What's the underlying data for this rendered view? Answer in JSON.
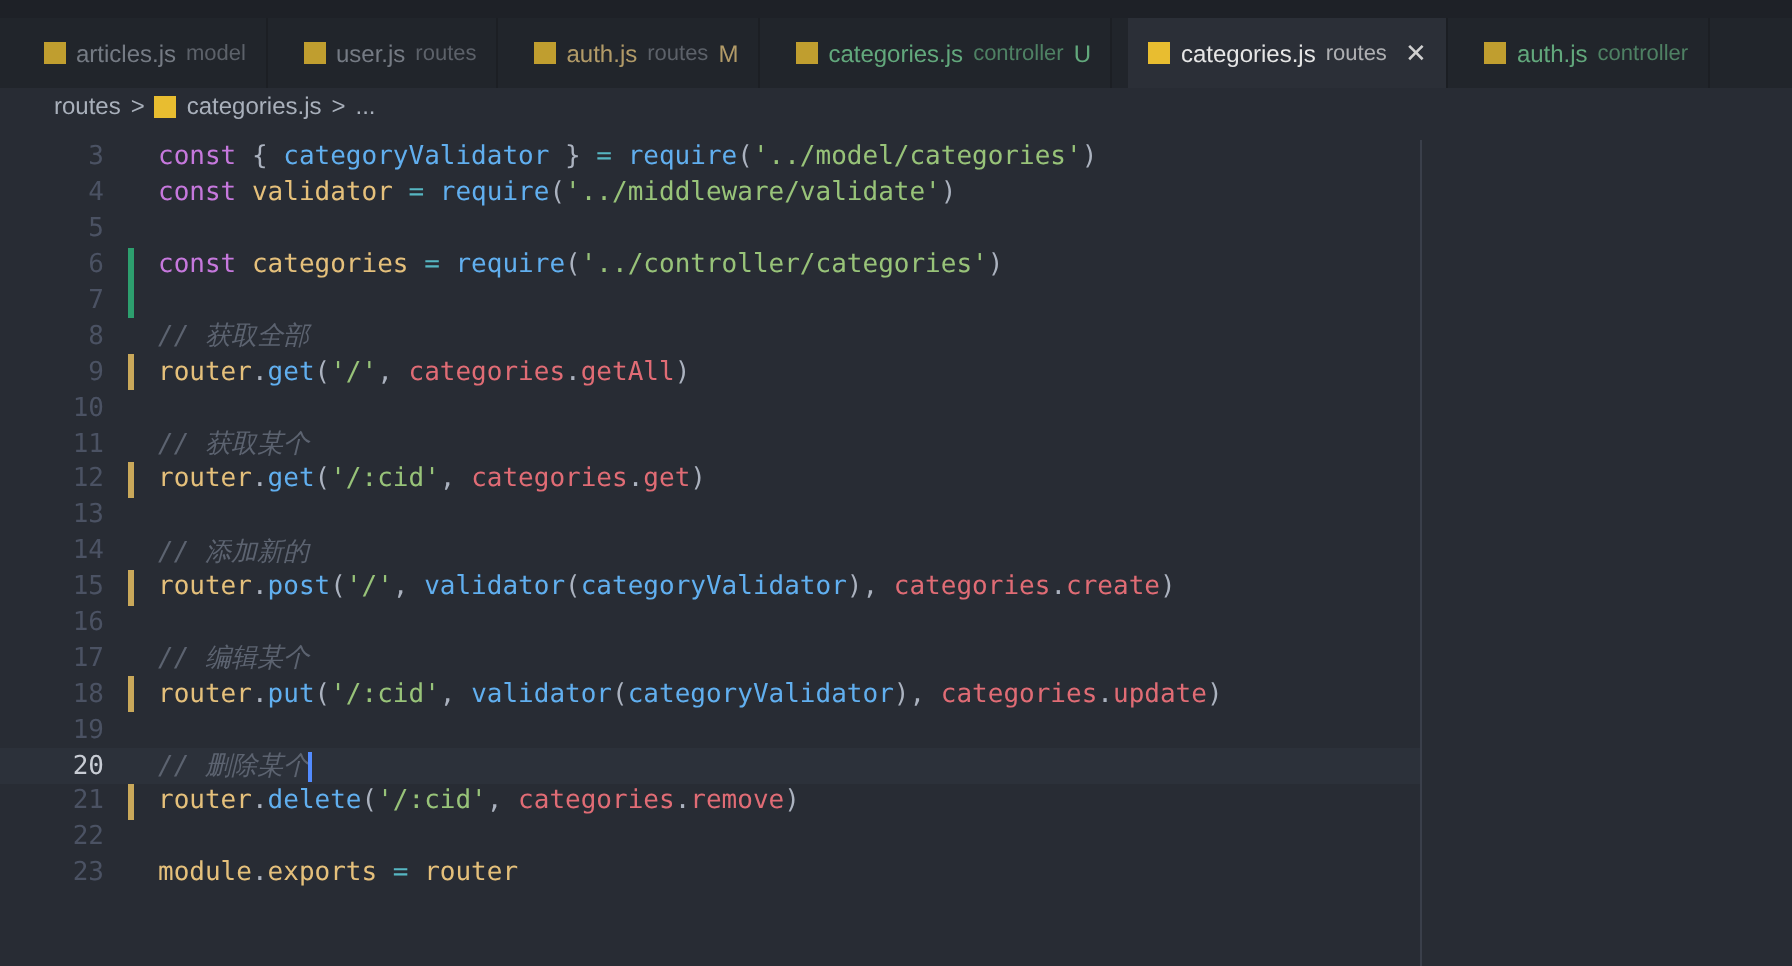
{
  "tabs": [
    {
      "name": "articles.js",
      "description": "model",
      "modified": false,
      "untracked": false,
      "selected": false
    },
    {
      "name": "user.js",
      "description": "routes",
      "modified": false,
      "untracked": false,
      "selected": false
    },
    {
      "name": "auth.js",
      "description": "routes",
      "modified": true,
      "untracked": false,
      "badge": "M",
      "selected": false
    },
    {
      "name": "categories.js",
      "description": "controller",
      "modified": false,
      "untracked": true,
      "badge": "U",
      "selected": false
    },
    {
      "name": "categories.js",
      "description": "routes",
      "modified": false,
      "untracked": false,
      "selected": true,
      "close": "✕"
    },
    {
      "name": "auth.js",
      "description": "controller",
      "modified": false,
      "untracked": true,
      "selected": false
    }
  ],
  "breadcrumb": {
    "folder": "routes",
    "separator_1": ">",
    "file": "categories.js",
    "separator_2": ">",
    "symbol": "..."
  },
  "lines": [
    {
      "number": "3",
      "added": false,
      "modified": false,
      "current": false,
      "tokens": [
        {
          "kind": "keyword",
          "text": "const"
        },
        {
          "kind": "punctuation",
          "text": " { "
        },
        {
          "kind": "function",
          "text": "categoryValidator"
        },
        {
          "kind": "punctuation",
          "text": " } "
        },
        {
          "kind": "operator",
          "text": "= "
        },
        {
          "kind": "function",
          "text": "require"
        },
        {
          "kind": "punctuation",
          "text": "("
        },
        {
          "kind": "string",
          "text": "'../model/categories'"
        },
        {
          "kind": "punctuation",
          "text": ")"
        }
      ]
    },
    {
      "number": "4",
      "added": false,
      "modified": false,
      "current": false,
      "tokens": [
        {
          "kind": "keyword",
          "text": "const "
        },
        {
          "kind": "variable",
          "text": "validator"
        },
        {
          "kind": "operator",
          "text": " = "
        },
        {
          "kind": "function",
          "text": "require"
        },
        {
          "kind": "punctuation",
          "text": "("
        },
        {
          "kind": "string",
          "text": "'../middleware/validate'"
        },
        {
          "kind": "punctuation",
          "text": ")"
        }
      ]
    },
    {
      "number": "5",
      "added": false,
      "modified": false,
      "current": false
    },
    {
      "number": "6",
      "added": true,
      "modified": false,
      "current": false,
      "tokens": [
        {
          "kind": "keyword",
          "text": "const "
        },
        {
          "kind": "variable",
          "text": "categories"
        },
        {
          "kind": "operator",
          "text": " = "
        },
        {
          "kind": "function",
          "text": "require"
        },
        {
          "kind": "punctuation",
          "text": "("
        },
        {
          "kind": "string",
          "text": "'../controller/categories'"
        },
        {
          "kind": "punctuation",
          "text": ")"
        }
      ]
    },
    {
      "number": "7",
      "added": true,
      "modified": false,
      "current": false
    },
    {
      "number": "8",
      "added": false,
      "modified": false,
      "current": false,
      "tokens": [
        {
          "kind": "comment",
          "text": "// 获取全部"
        }
      ]
    },
    {
      "number": "9",
      "added": false,
      "modified": true,
      "current": false,
      "tokens": [
        {
          "kind": "variable",
          "text": "router"
        },
        {
          "kind": "punctuation",
          "text": "."
        },
        {
          "kind": "function",
          "text": "get"
        },
        {
          "kind": "punctuation",
          "text": "("
        },
        {
          "kind": "string",
          "text": "'/'"
        },
        {
          "kind": "punctuation",
          "text": ", "
        },
        {
          "kind": "property",
          "text": "categories"
        },
        {
          "kind": "punctuation",
          "text": "."
        },
        {
          "kind": "property",
          "text": "getAll"
        },
        {
          "kind": "punctuation",
          "text": ")"
        }
      ]
    },
    {
      "number": "10",
      "added": false,
      "modified": false,
      "current": false
    },
    {
      "number": "11",
      "added": false,
      "modified": false,
      "current": false,
      "tokens": [
        {
          "kind": "comment",
          "text": "// 获取某个"
        }
      ]
    },
    {
      "number": "12",
      "added": false,
      "modified": true,
      "current": false,
      "tokens": [
        {
          "kind": "variable",
          "text": "router"
        },
        {
          "kind": "punctuation",
          "text": "."
        },
        {
          "kind": "function",
          "text": "get"
        },
        {
          "kind": "punctuation",
          "text": "("
        },
        {
          "kind": "string",
          "text": "'/:cid'"
        },
        {
          "kind": "punctuation",
          "text": ", "
        },
        {
          "kind": "property",
          "text": "categories"
        },
        {
          "kind": "punctuation",
          "text": "."
        },
        {
          "kind": "property",
          "text": "get"
        },
        {
          "kind": "punctuation",
          "text": ")"
        }
      ]
    },
    {
      "number": "13",
      "added": false,
      "modified": false,
      "current": false
    },
    {
      "number": "14",
      "added": false,
      "modified": false,
      "current": false,
      "tokens": [
        {
          "kind": "comment",
          "text": "// 添加新的"
        }
      ]
    },
    {
      "number": "15",
      "added": false,
      "modified": true,
      "current": false,
      "tokens": [
        {
          "kind": "variable",
          "text": "router"
        },
        {
          "kind": "punctuation",
          "text": "."
        },
        {
          "kind": "function",
          "text": "post"
        },
        {
          "kind": "punctuation",
          "text": "("
        },
        {
          "kind": "string",
          "text": "'/'"
        },
        {
          "kind": "punctuation",
          "text": ", "
        },
        {
          "kind": "function",
          "text": "validator"
        },
        {
          "kind": "punctuation",
          "text": "("
        },
        {
          "kind": "function",
          "text": "categoryValidator"
        },
        {
          "kind": "punctuation",
          "text": "), "
        },
        {
          "kind": "property",
          "text": "categories"
        },
        {
          "kind": "punctuation",
          "text": "."
        },
        {
          "kind": "property",
          "text": "create"
        },
        {
          "kind": "punctuation",
          "text": ")"
        }
      ]
    },
    {
      "number": "16",
      "added": false,
      "modified": false,
      "current": false
    },
    {
      "number": "17",
      "added": false,
      "modified": false,
      "current": false,
      "tokens": [
        {
          "kind": "comment",
          "text": "// 编辑某个"
        }
      ]
    },
    {
      "number": "18",
      "added": false,
      "modified": true,
      "current": false,
      "tokens": [
        {
          "kind": "variable",
          "text": "router"
        },
        {
          "kind": "punctuation",
          "text": "."
        },
        {
          "kind": "function",
          "text": "put"
        },
        {
          "kind": "punctuation",
          "text": "("
        },
        {
          "kind": "string",
          "text": "'/:cid'"
        },
        {
          "kind": "punctuation",
          "text": ", "
        },
        {
          "kind": "function",
          "text": "validator"
        },
        {
          "kind": "punctuation",
          "text": "("
        },
        {
          "kind": "function",
          "text": "categoryValidator"
        },
        {
          "kind": "punctuation",
          "text": "), "
        },
        {
          "kind": "property",
          "text": "categories"
        },
        {
          "kind": "punctuation",
          "text": "."
        },
        {
          "kind": "property",
          "text": "update"
        },
        {
          "kind": "punctuation",
          "text": ")"
        }
      ]
    },
    {
      "number": "19",
      "added": false,
      "modified": false,
      "current": false
    },
    {
      "number": "20",
      "added": false,
      "modified": false,
      "current": true,
      "tokens": [
        {
          "kind": "comment",
          "text": "// 删除某个"
        }
      ]
    },
    {
      "number": "21",
      "added": false,
      "modified": true,
      "current": false,
      "tokens": [
        {
          "kind": "variable",
          "text": "router"
        },
        {
          "kind": "punctuation",
          "text": "."
        },
        {
          "kind": "function",
          "text": "delete"
        },
        {
          "kind": "punctuation",
          "text": "("
        },
        {
          "kind": "string",
          "text": "'/:cid'"
        },
        {
          "kind": "punctuation",
          "text": ", "
        },
        {
          "kind": "property",
          "text": "categories"
        },
        {
          "kind": "punctuation",
          "text": "."
        },
        {
          "kind": "property",
          "text": "remove"
        },
        {
          "kind": "punctuation",
          "text": ")"
        }
      ]
    },
    {
      "number": "22",
      "added": false,
      "modified": false,
      "current": false
    },
    {
      "number": "23",
      "added": false,
      "modified": false,
      "current": false,
      "tokens": [
        {
          "kind": "variable",
          "text": "module"
        },
        {
          "kind": "punctuation",
          "text": "."
        },
        {
          "kind": "variable",
          "text": "exports"
        },
        {
          "kind": "operator",
          "text": " = "
        },
        {
          "kind": "variable",
          "text": "router"
        }
      ]
    }
  ]
}
